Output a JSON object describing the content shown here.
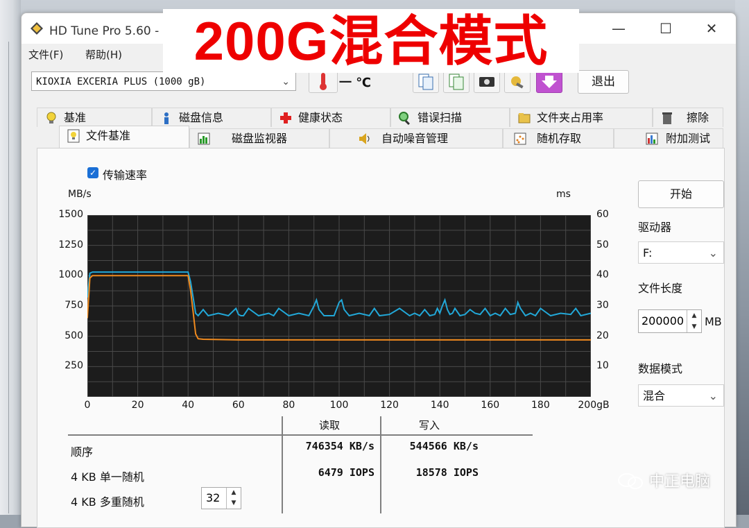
{
  "window": {
    "title": "HD Tune Pro 5.60 - 硬",
    "close": "✕",
    "maximize": "☐",
    "minimize": "—"
  },
  "menu": {
    "file": "文件(F)",
    "help": "帮助(H)"
  },
  "toolbar": {
    "drive": "KIOXIA  EXCERIA PLUS (1000 gB)",
    "temperature": "一 ℃",
    "exit_label": "退出"
  },
  "banner": {
    "text": "200G混合模式"
  },
  "tabs_row1": [
    {
      "label": "基准"
    },
    {
      "label": "磁盘信息"
    },
    {
      "label": "健康状态"
    },
    {
      "label": "错误扫描"
    },
    {
      "label": "文件夹占用率"
    },
    {
      "label": "擦除"
    }
  ],
  "tabs_row2": [
    {
      "label": "文件基准"
    },
    {
      "label": "磁盘监视器"
    },
    {
      "label": "自动噪音管理"
    },
    {
      "label": "随机存取"
    },
    {
      "label": "附加测试"
    }
  ],
  "panel": {
    "checkbox_label": "传输速率",
    "start_label": "开始",
    "drive_label": "驱动器",
    "drive_value": "F:",
    "file_length_label": "文件长度",
    "file_length_value": "200000",
    "file_length_unit": "MB",
    "data_mode_label": "数据模式",
    "data_mode_value": "混合"
  },
  "chart_data": {
    "type": "line",
    "ylabel_left": "MB/s",
    "ylabel_right": "ms",
    "y_left_ticks": [
      "1500",
      "1250",
      "1000",
      "750",
      "500",
      "250"
    ],
    "y_right_ticks": [
      "60",
      "50",
      "40",
      "30",
      "20",
      "10"
    ],
    "x_ticks": [
      "0",
      "20",
      "40",
      "60",
      "80",
      "100",
      "120",
      "140",
      "160",
      "180",
      "200gB"
    ],
    "xlim": [
      0,
      200
    ],
    "ylim_left": [
      0,
      1500
    ],
    "ylim_right": [
      0,
      60
    ],
    "grid": true,
    "series": [
      {
        "color": "#22a8d8",
        "x": [
          0,
          1,
          2,
          40,
          41,
          42,
          43,
          44,
          46,
          48,
          52,
          56,
          59,
          60,
          61,
          62,
          64,
          68,
          72,
          74,
          76,
          80,
          84,
          88,
          90,
          91,
          92,
          94,
          98,
          100,
          101,
          102,
          104,
          108,
          112,
          114,
          116,
          120,
          124,
          128,
          130,
          132,
          134,
          136,
          138,
          139,
          140,
          141,
          142,
          143,
          144,
          145,
          146,
          148,
          150,
          152,
          154,
          156,
          158,
          160,
          162,
          164,
          166,
          168,
          170,
          171,
          172,
          174,
          176,
          178,
          180,
          184,
          188,
          192,
          194,
          196,
          200
        ],
        "values": [
          820,
          1020,
          1030,
          1030,
          950,
          820,
          690,
          670,
          720,
          670,
          690,
          670,
          730,
          680,
          670,
          670,
          730,
          670,
          690,
          670,
          730,
          670,
          690,
          670,
          750,
          800,
          720,
          670,
          670,
          780,
          800,
          720,
          670,
          690,
          670,
          730,
          670,
          680,
          730,
          670,
          690,
          670,
          720,
          670,
          680,
          730,
          690,
          750,
          800,
          720,
          680,
          690,
          730,
          670,
          680,
          720,
          690,
          680,
          730,
          670,
          690,
          670,
          730,
          680,
          690,
          780,
          730,
          670,
          690,
          670,
          730,
          670,
          690,
          680,
          730,
          670,
          690
        ]
      },
      {
        "color": "#f08a1e",
        "x": [
          0,
          1,
          2,
          40,
          41,
          42,
          43,
          44,
          46,
          60,
          80,
          100,
          120,
          140,
          160,
          180,
          200
        ],
        "values": [
          650,
          980,
          1000,
          1000,
          880,
          700,
          520,
          480,
          475,
          470,
          470,
          470,
          470,
          470,
          470,
          470,
          470
        ]
      }
    ]
  },
  "results": {
    "col_read": "读取",
    "col_write": "写入",
    "rows": [
      {
        "label": "顺序",
        "read": "746354 KB/s",
        "write": "544566 KB/s"
      },
      {
        "label": "4 KB 单一随机",
        "read": "6479 IOPS",
        "write": "18578 IOPS"
      },
      {
        "label": "4 KB 多重随机",
        "read": "",
        "write": ""
      }
    ],
    "queue_depth": "32"
  },
  "watermark": {
    "text": "中正电脑"
  }
}
